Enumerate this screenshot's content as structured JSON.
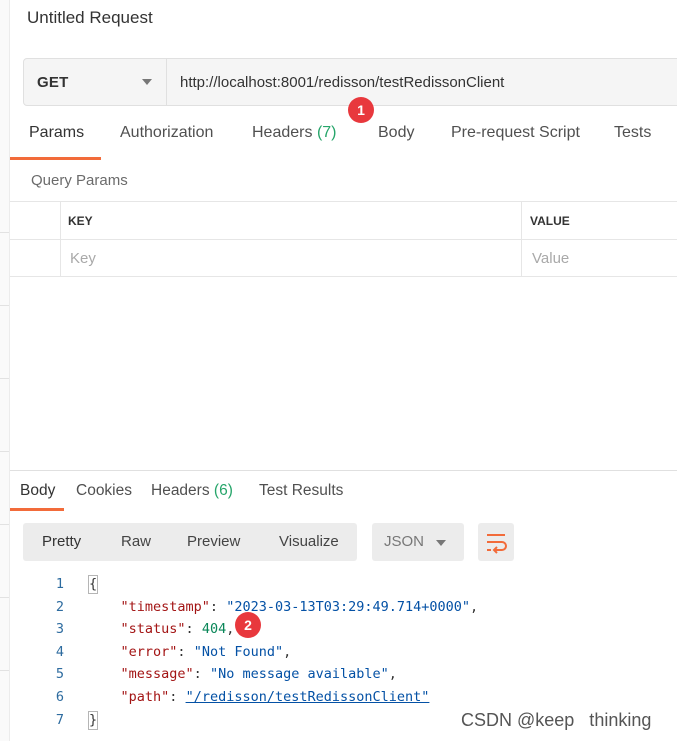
{
  "title": "Untitled Request",
  "request": {
    "method": "GET",
    "url": "http://localhost:8001/redisson/testRedissonClient"
  },
  "annotations": {
    "one": "1",
    "two": "2",
    "color": "#e8383d"
  },
  "request_tabs": [
    {
      "label": "Params",
      "active": true
    },
    {
      "label": "Authorization"
    },
    {
      "label": "Headers",
      "count": "(7)"
    },
    {
      "label": "Body"
    },
    {
      "label": "Pre-request Script"
    },
    {
      "label": "Tests"
    }
  ],
  "query_params": {
    "label": "Query Params",
    "headers": {
      "key": "KEY",
      "value": "VALUE"
    },
    "placeholders": {
      "key": "Key",
      "value": "Value"
    }
  },
  "response_tabs": [
    {
      "label": "Body",
      "active": true
    },
    {
      "label": "Cookies"
    },
    {
      "label": "Headers",
      "count": "(6)"
    },
    {
      "label": "Test Results"
    }
  ],
  "view_modes": [
    "Pretty",
    "Raw",
    "Preview",
    "Visualize"
  ],
  "format": "JSON",
  "icons": {
    "wrap": "wrap-lines-icon",
    "dropdown": "chevron-down-icon"
  },
  "accent_color": "#f26b3a",
  "response_body": {
    "line_numbers": [
      "1",
      "2",
      "3",
      "4",
      "5",
      "6",
      "7"
    ],
    "open_brace": "{",
    "close_brace": "}",
    "fields": [
      {
        "key": "\"timestamp\"",
        "value": "\"2023-03-13T03:29:49.714+0000\"",
        "type": "string"
      },
      {
        "key": "\"status\"",
        "value": "404",
        "type": "number"
      },
      {
        "key": "\"error\"",
        "value": "\"Not Found\"",
        "type": "string"
      },
      {
        "key": "\"message\"",
        "value": "\"No message available\"",
        "type": "string"
      },
      {
        "key": "\"path\"",
        "value": "\"/redisson/testRedissonClient\"",
        "type": "link"
      }
    ]
  },
  "watermark": "CSDN @keep   thinking"
}
